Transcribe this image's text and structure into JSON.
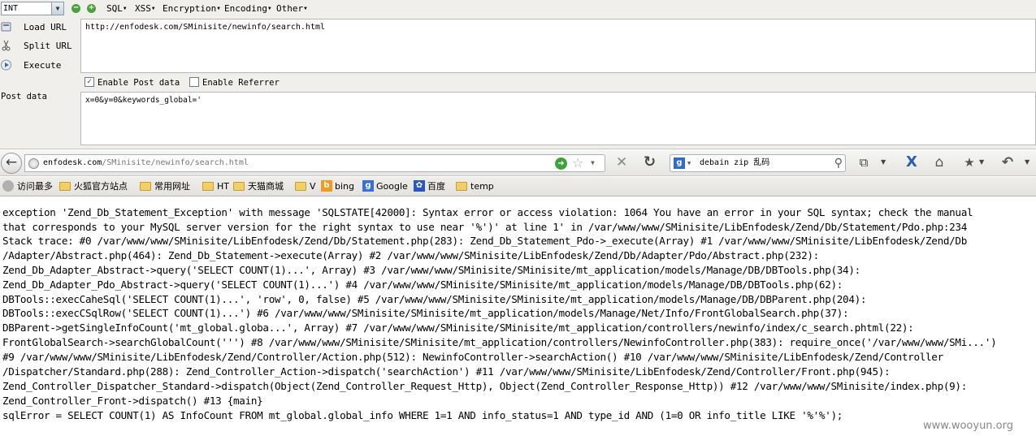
{
  "hackbar": {
    "type_select": "INT",
    "menus": [
      "SQL",
      "XSS",
      "Encryption",
      "Encoding",
      "Other"
    ],
    "load_url_label": "Load URL",
    "split_url_label": "Split URL",
    "execute_label": "Execute",
    "url_value": "http://enfodesk.com/SMinisite/newinfo/search.html",
    "enable_post_label": "Enable Post data",
    "enable_post_checked": true,
    "enable_referrer_label": "Enable Referrer",
    "enable_referrer_checked": false,
    "post_label": "Post data",
    "post_value": "x=0&y=0&keywords_global='"
  },
  "navbar": {
    "url_host": "enfodesk.com",
    "url_path": "/SMinisite/newinfo/search.html",
    "search_value": "debain zip 乱码"
  },
  "bookmarks": [
    "访问最多",
    "火狐官方站点",
    "常用网址",
    "HT",
    "天猫商城",
    "V",
    "bing",
    "Google",
    "百度",
    "temp"
  ],
  "content": {
    "lines": [
      "exception 'Zend_Db_Statement_Exception' with message 'SQLSTATE[42000]: Syntax error or access violation: 1064 You have an error in your SQL syntax; check the manual",
      "that corresponds to your MySQL server version for the right syntax to use near '%')' at line 1' in /var/www/www/SMinisite/LibEnfodesk/Zend/Db/Statement/Pdo.php:234",
      "Stack trace: #0 /var/www/www/SMinisite/LibEnfodesk/Zend/Db/Statement.php(283): Zend_Db_Statement_Pdo->_execute(Array) #1 /var/www/www/SMinisite/LibEnfodesk/Zend/Db",
      "/Adapter/Abstract.php(464): Zend_Db_Statement->execute(Array) #2 /var/www/www/SMinisite/LibEnfodesk/Zend/Db/Adapter/Pdo/Abstract.php(232):",
      "Zend_Db_Adapter_Abstract->query('SELECT COUNT(1)...', Array) #3 /var/www/www/SMinisite/SMinisite/mt_application/models/Manage/DB/DBTools.php(34):",
      "Zend_Db_Adapter_Pdo_Abstract->query('SELECT COUNT(1)...') #4 /var/www/www/SMinisite/SMinisite/mt_application/models/Manage/DB/DBTools.php(62):",
      "DBTools::execCaheSql('SELECT COUNT(1)...', 'row', 0, false) #5 /var/www/www/SMinisite/SMinisite/mt_application/models/Manage/DB/DBParent.php(204):",
      "DBTools::execCSqlRow('SELECT COUNT(1)...') #6 /var/www/www/SMinisite/SMinisite/mt_application/models/Manage/Net/Info/FrontGlobalSearch.php(37):",
      "DBParent->getSingleInfoCount('mt_global.globa...', Array) #7 /var/www/www/SMinisite/SMinisite/mt_application/controllers/newinfo/index/c_search.phtml(22):",
      "FrontGlobalSearch->searchGlobalCount(''') #8 /var/www/www/SMinisite/SMinisite/mt_application/controllers/NewinfoController.php(383): require_once('/var/www/www/SMi...')",
      "#9 /var/www/www/SMinisite/LibEnfodesk/Zend/Controller/Action.php(512): NewinfoController->searchAction() #10 /var/www/www/SMinisite/LibEnfodesk/Zend/Controller",
      "/Dispatcher/Standard.php(288): Zend_Controller_Action->dispatch('searchAction') #11 /var/www/www/SMinisite/LibEnfodesk/Zend/Controller/Front.php(945):",
      "Zend_Controller_Dispatcher_Standard->dispatch(Object(Zend_Controller_Request_Http), Object(Zend_Controller_Response_Http)) #12 /var/www/www/SMinisite/index.php(9):",
      "Zend_Controller_Front->dispatch() #13 {main}",
      "sqlError = SELECT COUNT(1) AS InfoCount FROM mt_global.global_info WHERE 1=1 AND info_status=1 AND type_id AND (1=0 OR info_title LIKE '%'%');"
    ],
    "watermark": "www.wooyun.org"
  }
}
